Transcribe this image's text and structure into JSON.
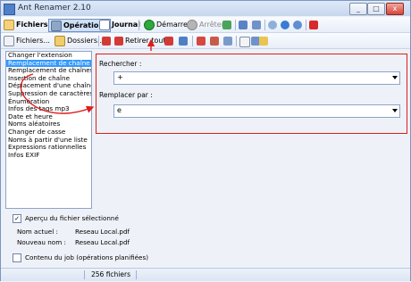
{
  "window": {
    "title": "Ant Renamer 2.10",
    "min": "_",
    "max": "□",
    "close": "x"
  },
  "toolbar1": {
    "files": "Fichiers",
    "operations": "Opérations",
    "journal": "Journal",
    "start": "Démarrer",
    "stop": "Arrêter"
  },
  "toolbar2": {
    "add_files": "Fichiers...",
    "add_folders": "Dossiers...",
    "remove_all": "Retirer tout"
  },
  "operations_list": [
    "Changer l'extension",
    "Remplacement de chaîne",
    "Remplacement de chaînes mul",
    "Insertion de chaîne",
    "Déplacement d'une chaîne",
    "Suppression de caractères",
    "Énumération",
    "Infos des tags mp3",
    "Date et heure",
    "Noms aléatoires",
    "Changer de casse",
    "Noms à partir d'une liste",
    "Expressions rationnelles",
    "Infos EXIF"
  ],
  "options": {
    "search_label": "Rechercher :",
    "search_value": "+",
    "replace_label": "Remplacer par :",
    "replace_value": "e"
  },
  "preview": {
    "checkbox_label": "Aperçu du fichier sélectionné",
    "current_name_label": "Nom actuel :",
    "current_name_value": "Reseau Local.pdf",
    "new_name_label": "Nouveau nom :",
    "new_name_value": "Reseau Local.pdf"
  },
  "job": {
    "checkbox_label": "Contenu du job (opérations planifiées)"
  },
  "status": {
    "count": "256 fichiers"
  },
  "colors": {
    "annotation_red": "#e11c1c",
    "selection_blue": "#3399ff"
  }
}
